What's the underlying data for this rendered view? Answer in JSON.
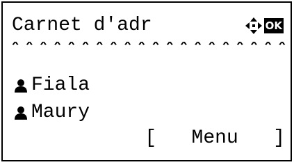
{
  "screen": {
    "title": "Carnet d'adr",
    "nav_icon": "four-way-arrow-icon",
    "ok_label": "OK",
    "divider_text": "********************"
  },
  "list": {
    "items": [
      {
        "icon": "person-icon",
        "label": "Fiala"
      },
      {
        "icon": "person-icon",
        "label": "Maury"
      }
    ]
  },
  "softkey": {
    "open": "[",
    "label": "Menu",
    "close": "]"
  },
  "colors": {
    "foreground": "#000000",
    "background": "#ffffff"
  }
}
